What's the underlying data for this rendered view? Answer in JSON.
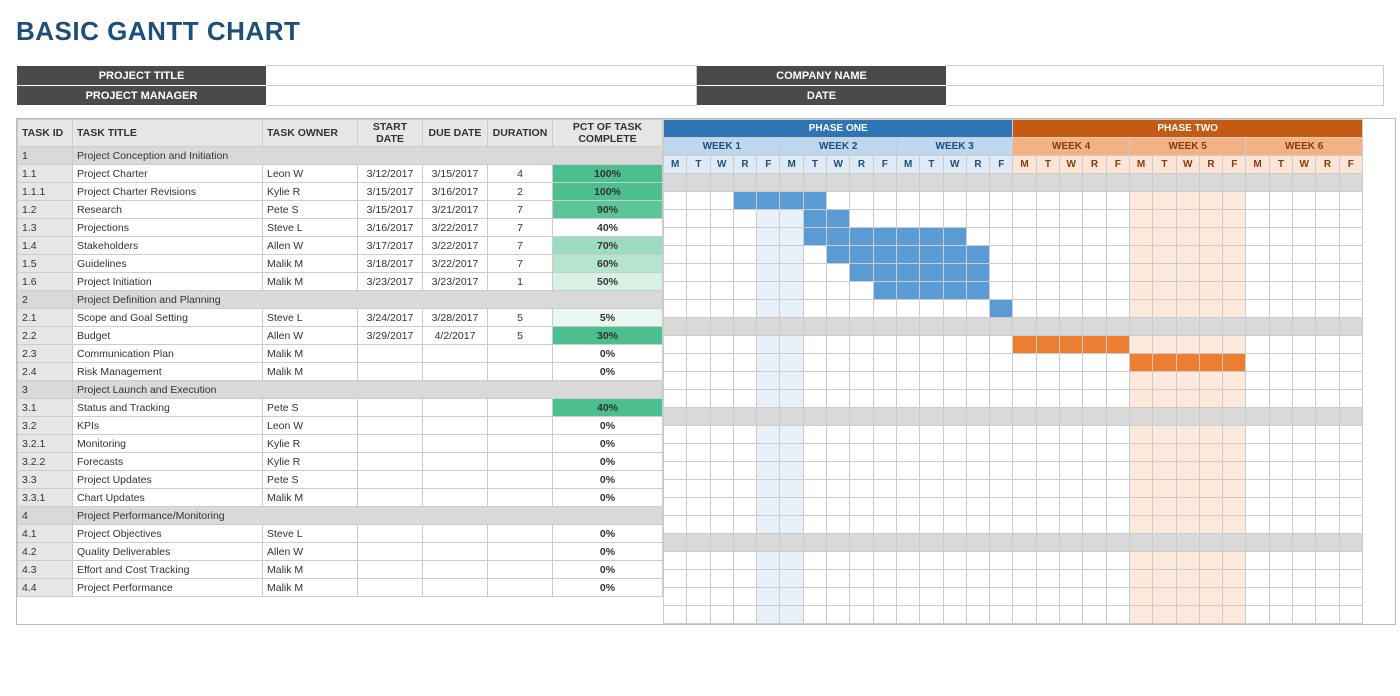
{
  "title": "BASIC GANTT CHART",
  "meta": {
    "project_title_label": "PROJECT TITLE",
    "project_title": "",
    "company_label": "COMPANY NAME",
    "company": "",
    "manager_label": "PROJECT MANAGER",
    "manager": "",
    "date_label": "DATE",
    "date": ""
  },
  "columns": {
    "id": "TASK ID",
    "title": "TASK TITLE",
    "owner": "TASK OWNER",
    "start": "START DATE",
    "due": "DUE DATE",
    "dur": "DURATION",
    "pct": "PCT OF TASK COMPLETE"
  },
  "phases": [
    {
      "name": "PHASE ONE",
      "weeks": [
        "WEEK 1",
        "WEEK 2",
        "WEEK 3"
      ],
      "cls": "1"
    },
    {
      "name": "PHASE TWO",
      "weeks": [
        "WEEK 4",
        "WEEK 5",
        "WEEK 6"
      ],
      "cls": "2"
    }
  ],
  "days": [
    "M",
    "T",
    "W",
    "R",
    "F"
  ],
  "pct_colors": {
    "100": "#4bbf8f",
    "90": "#5cc698",
    "70": "#9ddcc1",
    "60": "#b5e4cf",
    "50": "#d8f1e5",
    "40_g": "#4bbf8f",
    "40": "#ffffff",
    "30": "#4bbf8f",
    "5": "#eaf7f0",
    "0": "#ffffff"
  },
  "rows": [
    {
      "id": "1",
      "title": "Project Conception and Initiation",
      "section": true
    },
    {
      "id": "1.1",
      "title": "Project Charter",
      "owner": "Leon W",
      "start": "3/12/2017",
      "due": "3/15/2017",
      "dur": "4",
      "pct": "100%",
      "pk": "100",
      "bar": [
        3,
        6
      ],
      "phase": 1
    },
    {
      "id": "1.1.1",
      "title": "Project Charter Revisions",
      "owner": "Kylie R",
      "start": "3/15/2017",
      "due": "3/16/2017",
      "dur": "2",
      "pct": "100%",
      "pk": "100",
      "bar": [
        6,
        7
      ],
      "phase": 1
    },
    {
      "id": "1.2",
      "title": "Research",
      "owner": "Pete S",
      "start": "3/15/2017",
      "due": "3/21/2017",
      "dur": "7",
      "pct": "90%",
      "pk": "90",
      "bar": [
        6,
        12
      ],
      "phase": 1
    },
    {
      "id": "1.3",
      "title": "Projections",
      "owner": "Steve L",
      "start": "3/16/2017",
      "due": "3/22/2017",
      "dur": "7",
      "pct": "40%",
      "pk": "40",
      "bar": [
        7,
        13
      ],
      "phase": 1
    },
    {
      "id": "1.4",
      "title": "Stakeholders",
      "owner": "Allen W",
      "start": "3/17/2017",
      "due": "3/22/2017",
      "dur": "7",
      "pct": "70%",
      "pk": "70",
      "bar": [
        8,
        13
      ],
      "phase": 1
    },
    {
      "id": "1.5",
      "title": "Guidelines",
      "owner": "Malik M",
      "start": "3/18/2017",
      "due": "3/22/2017",
      "dur": "7",
      "pct": "60%",
      "pk": "60",
      "bar": [
        9,
        13
      ],
      "phase": 1
    },
    {
      "id": "1.6",
      "title": "Project Initiation",
      "owner": "Malik M",
      "start": "3/23/2017",
      "due": "3/23/2017",
      "dur": "1",
      "pct": "50%",
      "pk": "50",
      "bar": [
        14,
        14
      ],
      "phase": 1
    },
    {
      "id": "2",
      "title": "Project Definition and Planning",
      "section": true
    },
    {
      "id": "2.1",
      "title": "Scope and Goal Setting",
      "owner": "Steve L",
      "start": "3/24/2017",
      "due": "3/28/2017",
      "dur": "5",
      "pct": "5%",
      "pk": "5",
      "bar": [
        15,
        19
      ],
      "phase": 2
    },
    {
      "id": "2.2",
      "title": "Budget",
      "owner": "Allen W",
      "start": "3/29/2017",
      "due": "4/2/2017",
      "dur": "5",
      "pct": "30%",
      "pk": "30",
      "bar": [
        20,
        24
      ],
      "phase": 2
    },
    {
      "id": "2.3",
      "title": "Communication Plan",
      "owner": "Malik M",
      "start": "",
      "due": "",
      "dur": "",
      "pct": "0%",
      "pk": "0"
    },
    {
      "id": "2.4",
      "title": "Risk Management",
      "owner": "Malik M",
      "start": "",
      "due": "",
      "dur": "",
      "pct": "0%",
      "pk": "0"
    },
    {
      "id": "3",
      "title": "Project Launch and Execution",
      "section": true
    },
    {
      "id": "3.1",
      "title": "Status and Tracking",
      "owner": "Pete S",
      "start": "",
      "due": "",
      "dur": "",
      "pct": "40%",
      "pk": "40_g"
    },
    {
      "id": "3.2",
      "title": "KPIs",
      "owner": "Leon W",
      "start": "",
      "due": "",
      "dur": "",
      "pct": "0%",
      "pk": "0"
    },
    {
      "id": "3.2.1",
      "title": "Monitoring",
      "owner": "Kylie R",
      "start": "",
      "due": "",
      "dur": "",
      "pct": "0%",
      "pk": "0"
    },
    {
      "id": "3.2.2",
      "title": "Forecasts",
      "owner": "Kylie R",
      "start": "",
      "due": "",
      "dur": "",
      "pct": "0%",
      "pk": "0"
    },
    {
      "id": "3.3",
      "title": "Project Updates",
      "owner": "Pete S",
      "start": "",
      "due": "",
      "dur": "",
      "pct": "0%",
      "pk": "0"
    },
    {
      "id": "3.3.1",
      "title": "Chart Updates",
      "owner": "Malik M",
      "start": "",
      "due": "",
      "dur": "",
      "pct": "0%",
      "pk": "0"
    },
    {
      "id": "4",
      "title": "Project Performance/Monitoring",
      "section": true
    },
    {
      "id": "4.1",
      "title": "Project Objectives",
      "owner": "Steve L",
      "start": "",
      "due": "",
      "dur": "",
      "pct": "0%",
      "pk": "0"
    },
    {
      "id": "4.2",
      "title": "Quality Deliverables",
      "owner": "Allen W",
      "start": "",
      "due": "",
      "dur": "",
      "pct": "0%",
      "pk": "0"
    },
    {
      "id": "4.3",
      "title": "Effort and Cost Tracking",
      "owner": "Malik M",
      "start": "",
      "due": "",
      "dur": "",
      "pct": "0%",
      "pk": "0"
    },
    {
      "id": "4.4",
      "title": "Project Performance",
      "owner": "Malik M",
      "start": "",
      "due": "",
      "dur": "",
      "pct": "0%",
      "pk": "0"
    }
  ],
  "gantt_shade": {
    "phase1_cols": [
      4,
      5
    ],
    "phase2_cols": [
      20,
      21,
      22,
      23,
      24
    ]
  },
  "chart_data": {
    "type": "gantt",
    "title": "BASIC GANTT CHART",
    "phases": [
      {
        "name": "PHASE ONE",
        "weeks": [
          "WEEK 1",
          "WEEK 2",
          "WEEK 3"
        ]
      },
      {
        "name": "PHASE TWO",
        "weeks": [
          "WEEK 4",
          "WEEK 5",
          "WEEK 6"
        ]
      }
    ],
    "day_columns": [
      "M",
      "T",
      "W",
      "R",
      "F"
    ],
    "date_origin": "3/12/2017 is column index 3 (0-based, M of WEEK 1 is index 0); weekends skipped",
    "tasks": [
      {
        "id": "1.1",
        "name": "Project Charter",
        "owner": "Leon W",
        "start": "3/12/2017",
        "end": "3/15/2017",
        "duration_days": 4,
        "pct_complete": 100,
        "bar_cols": [
          3,
          6
        ]
      },
      {
        "id": "1.1.1",
        "name": "Project Charter Revisions",
        "owner": "Kylie R",
        "start": "3/15/2017",
        "end": "3/16/2017",
        "duration_days": 2,
        "pct_complete": 100,
        "bar_cols": [
          6,
          7
        ]
      },
      {
        "id": "1.2",
        "name": "Research",
        "owner": "Pete S",
        "start": "3/15/2017",
        "end": "3/21/2017",
        "duration_days": 7,
        "pct_complete": 90,
        "bar_cols": [
          6,
          12
        ]
      },
      {
        "id": "1.3",
        "name": "Projections",
        "owner": "Steve L",
        "start": "3/16/2017",
        "end": "3/22/2017",
        "duration_days": 7,
        "pct_complete": 40,
        "bar_cols": [
          7,
          13
        ]
      },
      {
        "id": "1.4",
        "name": "Stakeholders",
        "owner": "Allen W",
        "start": "3/17/2017",
        "end": "3/22/2017",
        "duration_days": 7,
        "pct_complete": 70,
        "bar_cols": [
          8,
          13
        ]
      },
      {
        "id": "1.5",
        "name": "Guidelines",
        "owner": "Malik M",
        "start": "3/18/2017",
        "end": "3/22/2017",
        "duration_days": 7,
        "pct_complete": 60,
        "bar_cols": [
          9,
          13
        ]
      },
      {
        "id": "1.6",
        "name": "Project Initiation",
        "owner": "Malik M",
        "start": "3/23/2017",
        "end": "3/23/2017",
        "duration_days": 1,
        "pct_complete": 50,
        "bar_cols": [
          14,
          14
        ]
      },
      {
        "id": "2.1",
        "name": "Scope and Goal Setting",
        "owner": "Steve L",
        "start": "3/24/2017",
        "end": "3/28/2017",
        "duration_days": 5,
        "pct_complete": 5,
        "bar_cols": [
          15,
          19
        ]
      },
      {
        "id": "2.2",
        "name": "Budget",
        "owner": "Allen W",
        "start": "3/29/2017",
        "end": "4/2/2017",
        "duration_days": 5,
        "pct_complete": 30,
        "bar_cols": [
          20,
          24
        ]
      },
      {
        "id": "2.3",
        "name": "Communication Plan",
        "owner": "Malik M",
        "pct_complete": 0
      },
      {
        "id": "2.4",
        "name": "Risk Management",
        "owner": "Malik M",
        "pct_complete": 0
      },
      {
        "id": "3.1",
        "name": "Status and Tracking",
        "owner": "Pete S",
        "pct_complete": 40
      },
      {
        "id": "3.2",
        "name": "KPIs",
        "owner": "Leon W",
        "pct_complete": 0
      },
      {
        "id": "3.2.1",
        "name": "Monitoring",
        "owner": "Kylie R",
        "pct_complete": 0
      },
      {
        "id": "3.2.2",
        "name": "Forecasts",
        "owner": "Kylie R",
        "pct_complete": 0
      },
      {
        "id": "3.3",
        "name": "Project Updates",
        "owner": "Pete S",
        "pct_complete": 0
      },
      {
        "id": "3.3.1",
        "name": "Chart Updates",
        "owner": "Malik M",
        "pct_complete": 0
      },
      {
        "id": "4.1",
        "name": "Project Objectives",
        "owner": "Steve L",
        "pct_complete": 0
      },
      {
        "id": "4.2",
        "name": "Quality Deliverables",
        "owner": "Allen W",
        "pct_complete": 0
      },
      {
        "id": "4.3",
        "name": "Effort and Cost Tracking",
        "owner": "Malik M",
        "pct_complete": 0
      },
      {
        "id": "4.4",
        "name": "Project Performance",
        "owner": "Malik M",
        "pct_complete": 0
      }
    ]
  }
}
